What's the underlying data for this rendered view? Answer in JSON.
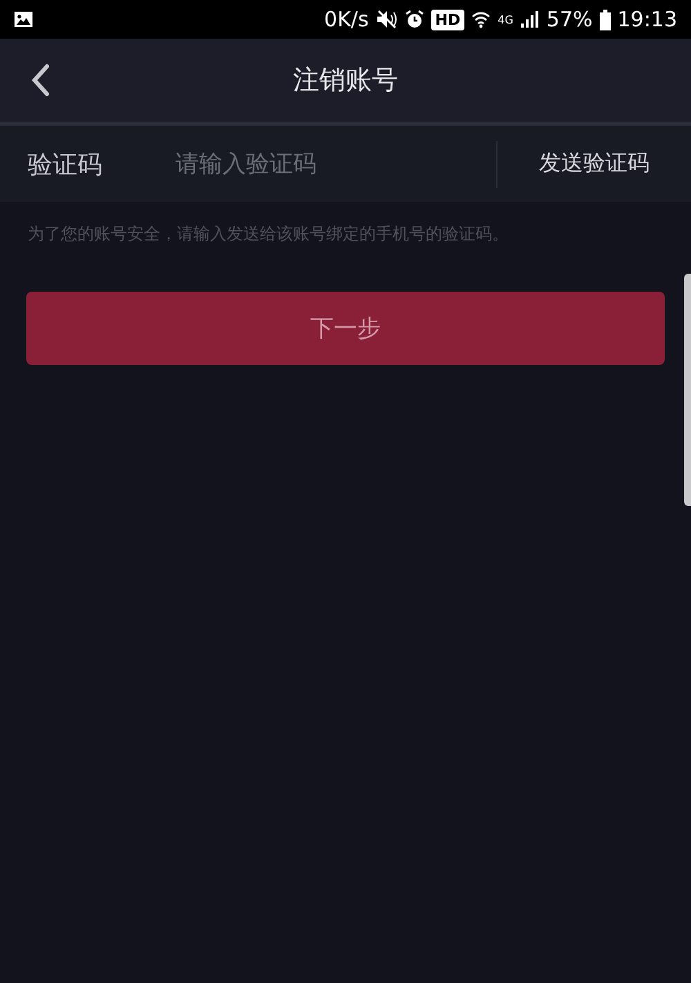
{
  "status_bar": {
    "speed": "0K/s",
    "hd_badge": "HD",
    "network": "4G",
    "battery": "57%",
    "time": "19:13"
  },
  "nav": {
    "title": "注销账号"
  },
  "code_field": {
    "label": "验证码",
    "placeholder": "请输入验证码",
    "send_button": "发送验证码"
  },
  "hint": "为了您的账号安全，请输入发送给该账号绑定的手机号的验证码。",
  "next_button": {
    "label": "下一步",
    "disabled": true
  }
}
